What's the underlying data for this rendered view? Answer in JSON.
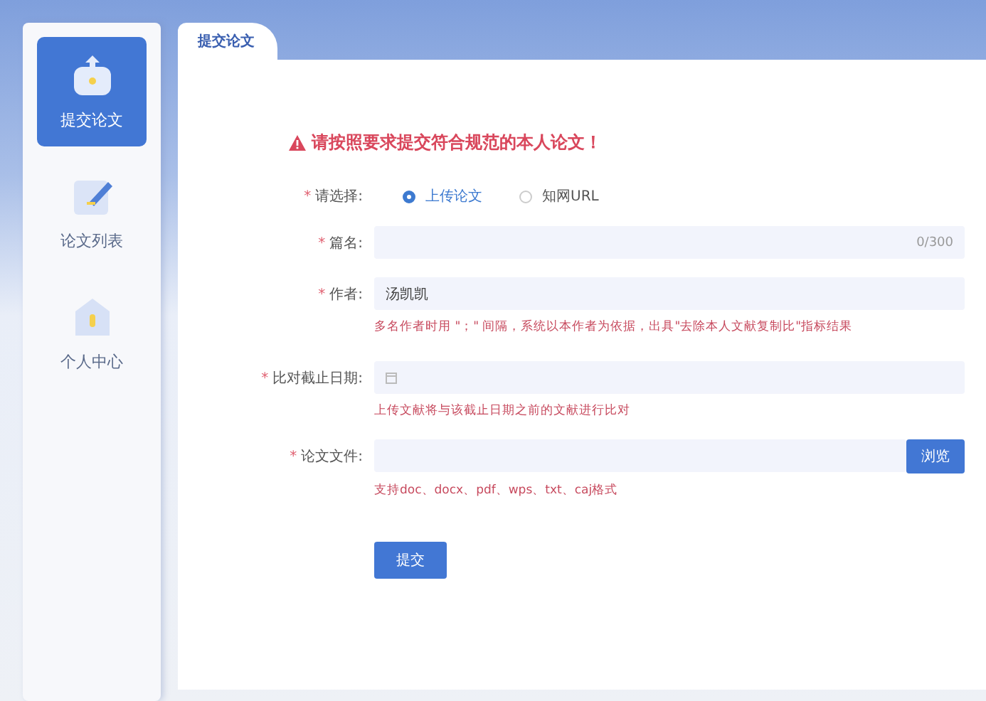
{
  "sidebar": {
    "items": [
      {
        "label": "提交论文",
        "kind": "upload",
        "selected": true
      },
      {
        "label": "论文列表",
        "kind": "edit",
        "selected": false
      },
      {
        "label": "个人中心",
        "kind": "home",
        "selected": false
      }
    ]
  },
  "tabs": [
    {
      "label": "提交论文",
      "selected": true
    }
  ],
  "warning": "请按照要求提交符合规范的本人论文！",
  "form": {
    "fields": [
      {
        "kind": "radio",
        "label": "请选择:",
        "required": "*",
        "options": [
          {
            "label": "上传论文",
            "selected": true
          },
          {
            "label": "知网URL",
            "selected": false
          }
        ]
      },
      {
        "kind": "text",
        "label": "篇名:",
        "required": "*",
        "counter": "0/300"
      },
      {
        "kind": "text",
        "label": "作者:",
        "required": "*",
        "value": "汤凯凯",
        "hint": "多名作者时用 \"；\" 间隔，系统以本作者为依据，出具\"去除本人文献复制比\"指标结果"
      },
      {
        "kind": "date",
        "label": "比对截止日期:",
        "required": "*",
        "hint": "上传文献将与该截止日期之前的文献进行比对"
      },
      {
        "kind": "file",
        "label": "论文文件:",
        "required": "*",
        "button": "浏览",
        "hint": "支持doc、docx、pdf、wps、txt、caj格式"
      }
    ],
    "submit": "提交"
  }
}
